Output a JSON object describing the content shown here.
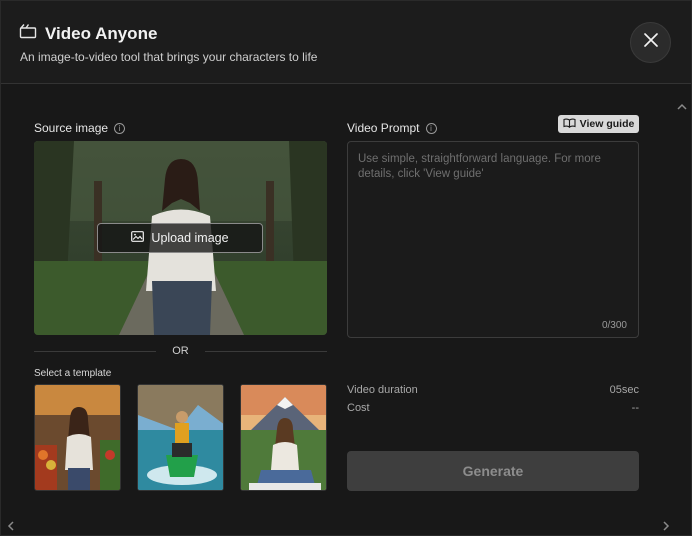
{
  "header": {
    "title": "Video Anyone",
    "subtitle": "An image-to-video tool that brings your characters to life",
    "close_icon": "close-icon"
  },
  "source": {
    "label": "Source image",
    "upload_label": "Upload image"
  },
  "divider": {
    "text": "OR"
  },
  "templates": {
    "label": "Select a template",
    "items": [
      {
        "name": "market-woman-template"
      },
      {
        "name": "jet-ski-template"
      },
      {
        "name": "mountain-woman-template"
      }
    ]
  },
  "prompt": {
    "label": "Video Prompt",
    "guide_label": "View guide",
    "placeholder": "Use simple, straightforward language. For more details, click 'View guide'",
    "value": "",
    "counter": "0/300"
  },
  "meta": {
    "duration_label": "Video duration",
    "duration_value": "05sec",
    "cost_label": "Cost",
    "cost_value": "--"
  },
  "actions": {
    "generate_label": "Generate"
  },
  "colors": {
    "background": "#181818",
    "header": "#1c1c1c",
    "guide_button": "#d9d9d9",
    "generate_disabled": "#3e3e3e"
  }
}
